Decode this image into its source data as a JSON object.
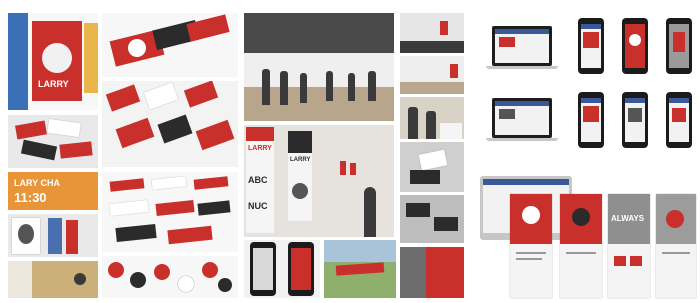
{
  "collage": {
    "poster_small_text": "LARRY",
    "orange_tile_line1": "LARY CHA",
    "orange_tile_line2": "11:30",
    "poster_letters": "ABC",
    "poster_title": "LARRY",
    "poster_footer": "NUC",
    "standee_title": "LARRY",
    "email_banner": "ALWAYS",
    "accent_red": "#c9302c",
    "accent_orange": "#e8953a"
  }
}
